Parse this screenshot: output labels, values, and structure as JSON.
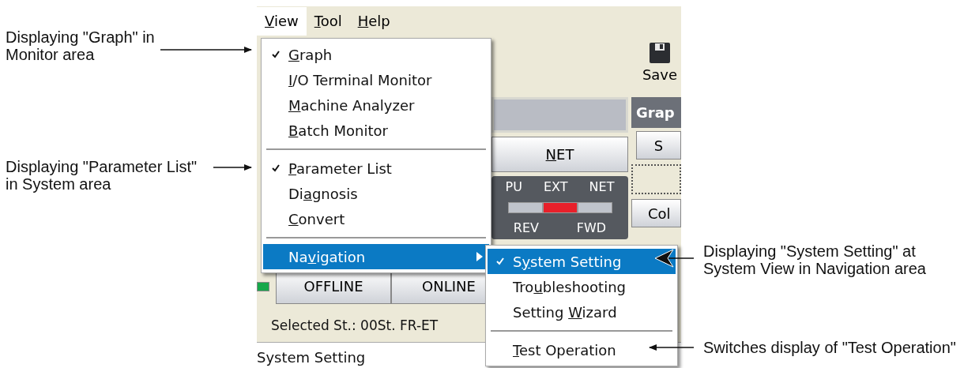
{
  "callouts_left": [
    {
      "text": "Displaying \"Graph\" in Monitor area"
    },
    {
      "text": "Displaying \"Parameter List\" in System area"
    }
  ],
  "callouts_right": [
    {
      "text": "Displaying \"System Setting\" at System View in Navigation area"
    },
    {
      "text": "Switches display of \"Test Operation\""
    }
  ],
  "menu_bar": [
    {
      "access_key": "V",
      "text_after": "iew",
      "selected": true
    },
    {
      "access_key": "T",
      "text_after": "ool",
      "selected": false
    },
    {
      "access_key": "H",
      "text_after": "elp",
      "selected": false
    }
  ],
  "view_menu": [
    {
      "kind": "item",
      "access_key": "G",
      "text_after": "raph",
      "checked": true,
      "selected": false
    },
    {
      "kind": "item",
      "access_key": "I",
      "text_after": "/O Terminal Monitor",
      "checked": false,
      "selected": false
    },
    {
      "kind": "item",
      "access_key": "M",
      "text_after": "achine Analyzer",
      "checked": false,
      "selected": false
    },
    {
      "kind": "item",
      "access_key": "B",
      "text_after": "atch Monitor",
      "checked": false,
      "selected": false
    },
    {
      "kind": "separator"
    },
    {
      "kind": "item",
      "access_key": "P",
      "text_after": "arameter List",
      "checked": true,
      "selected": false
    },
    {
      "kind": "item",
      "text_before": "Di",
      "access_key": "a",
      "text_after": "gnosis",
      "checked": false,
      "selected": false
    },
    {
      "kind": "item",
      "access_key": "C",
      "text_after": "onvert",
      "checked": false,
      "selected": false
    },
    {
      "kind": "separator"
    },
    {
      "kind": "submenu",
      "text_before": "Na",
      "access_key": "v",
      "text_after": "igation",
      "checked": false,
      "selected": true
    }
  ],
  "navigation_submenu": [
    {
      "kind": "item",
      "text_before": "S",
      "access_key": "y",
      "text_after": "stem Setting",
      "checked": true,
      "selected": true
    },
    {
      "kind": "item",
      "text_before": "Tro",
      "access_key": "u",
      "text_after": "bleshooting",
      "checked": false,
      "selected": false
    },
    {
      "kind": "item",
      "text_before": "Setting ",
      "access_key": "W",
      "text_after": "izard",
      "checked": false,
      "selected": false
    },
    {
      "kind": "separator"
    },
    {
      "kind": "item",
      "access_key": "T",
      "text_after": "est Operation",
      "checked": false,
      "selected": false
    }
  ],
  "toolbar": {
    "save_label": "Save"
  },
  "net_button": {
    "access_key": "N",
    "text_after": "ET"
  },
  "operation_panel": {
    "mode_labels": [
      "PU",
      "EXT",
      "NET"
    ],
    "indicators": [
      {
        "on": false
      },
      {
        "on": true
      },
      {
        "on": false
      }
    ],
    "direction_labels": [
      "REV",
      "FWD"
    ]
  },
  "graph_panel": {
    "title": "Grap",
    "button_label": "S",
    "column_label": "Col"
  },
  "connection_led": {
    "on": true
  },
  "connection_buttons": [
    "OFFLINE",
    "ONLINE"
  ],
  "selected_station": "Selected St.: 00St. FR-ET",
  "status_bar": "System Setting"
}
